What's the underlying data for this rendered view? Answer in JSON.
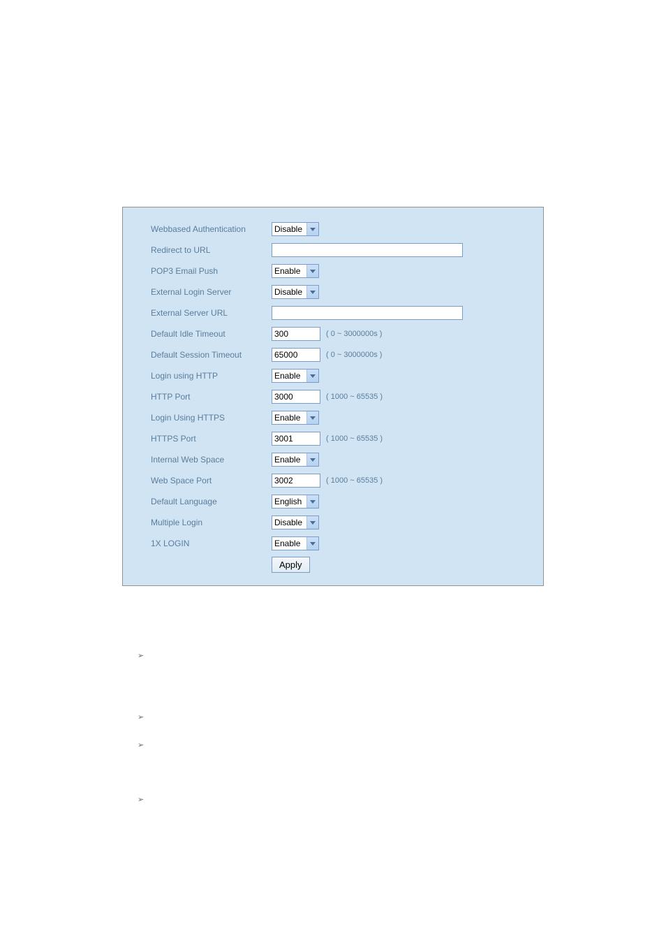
{
  "fields": {
    "webbased_auth": {
      "label": "Webbased Authentication",
      "value": "Disable"
    },
    "redirect_url": {
      "label": "Redirect to URL",
      "value": ""
    },
    "pop3_push": {
      "label": "POP3 Email Push",
      "value": "Enable"
    },
    "ext_login_server": {
      "label": "External Login Server",
      "value": "Disable"
    },
    "ext_server_url": {
      "label": "External Server URL",
      "value": ""
    },
    "idle_timeout": {
      "label": "Default Idle Timeout",
      "value": "300",
      "hint": "( 0 ~ 3000000s )"
    },
    "session_timeout": {
      "label": "Default Session Timeout",
      "value": "65000",
      "hint": "( 0 ~ 3000000s )"
    },
    "login_http": {
      "label": "Login using HTTP",
      "value": "Enable"
    },
    "http_port": {
      "label": "HTTP Port",
      "value": "3000",
      "hint": "( 1000 ~ 65535 )"
    },
    "login_https": {
      "label": "Login Using HTTPS",
      "value": "Enable"
    },
    "https_port": {
      "label": "HTTPS Port",
      "value": "3001",
      "hint": "( 1000 ~ 65535 )"
    },
    "internal_web_space": {
      "label": "Internal Web Space",
      "value": "Enable"
    },
    "web_space_port": {
      "label": "Web Space Port",
      "value": "3002",
      "hint": "( 1000 ~ 65535 )"
    },
    "default_language": {
      "label": "Default Language",
      "value": "English"
    },
    "multiple_login": {
      "label": "Multiple Login",
      "value": "Disable"
    },
    "one_x_login": {
      "label": "1X LOGIN",
      "value": "Enable"
    }
  },
  "apply_label": "Apply",
  "bullets": [
    "➢",
    "➢",
    "➢",
    "➢"
  ]
}
